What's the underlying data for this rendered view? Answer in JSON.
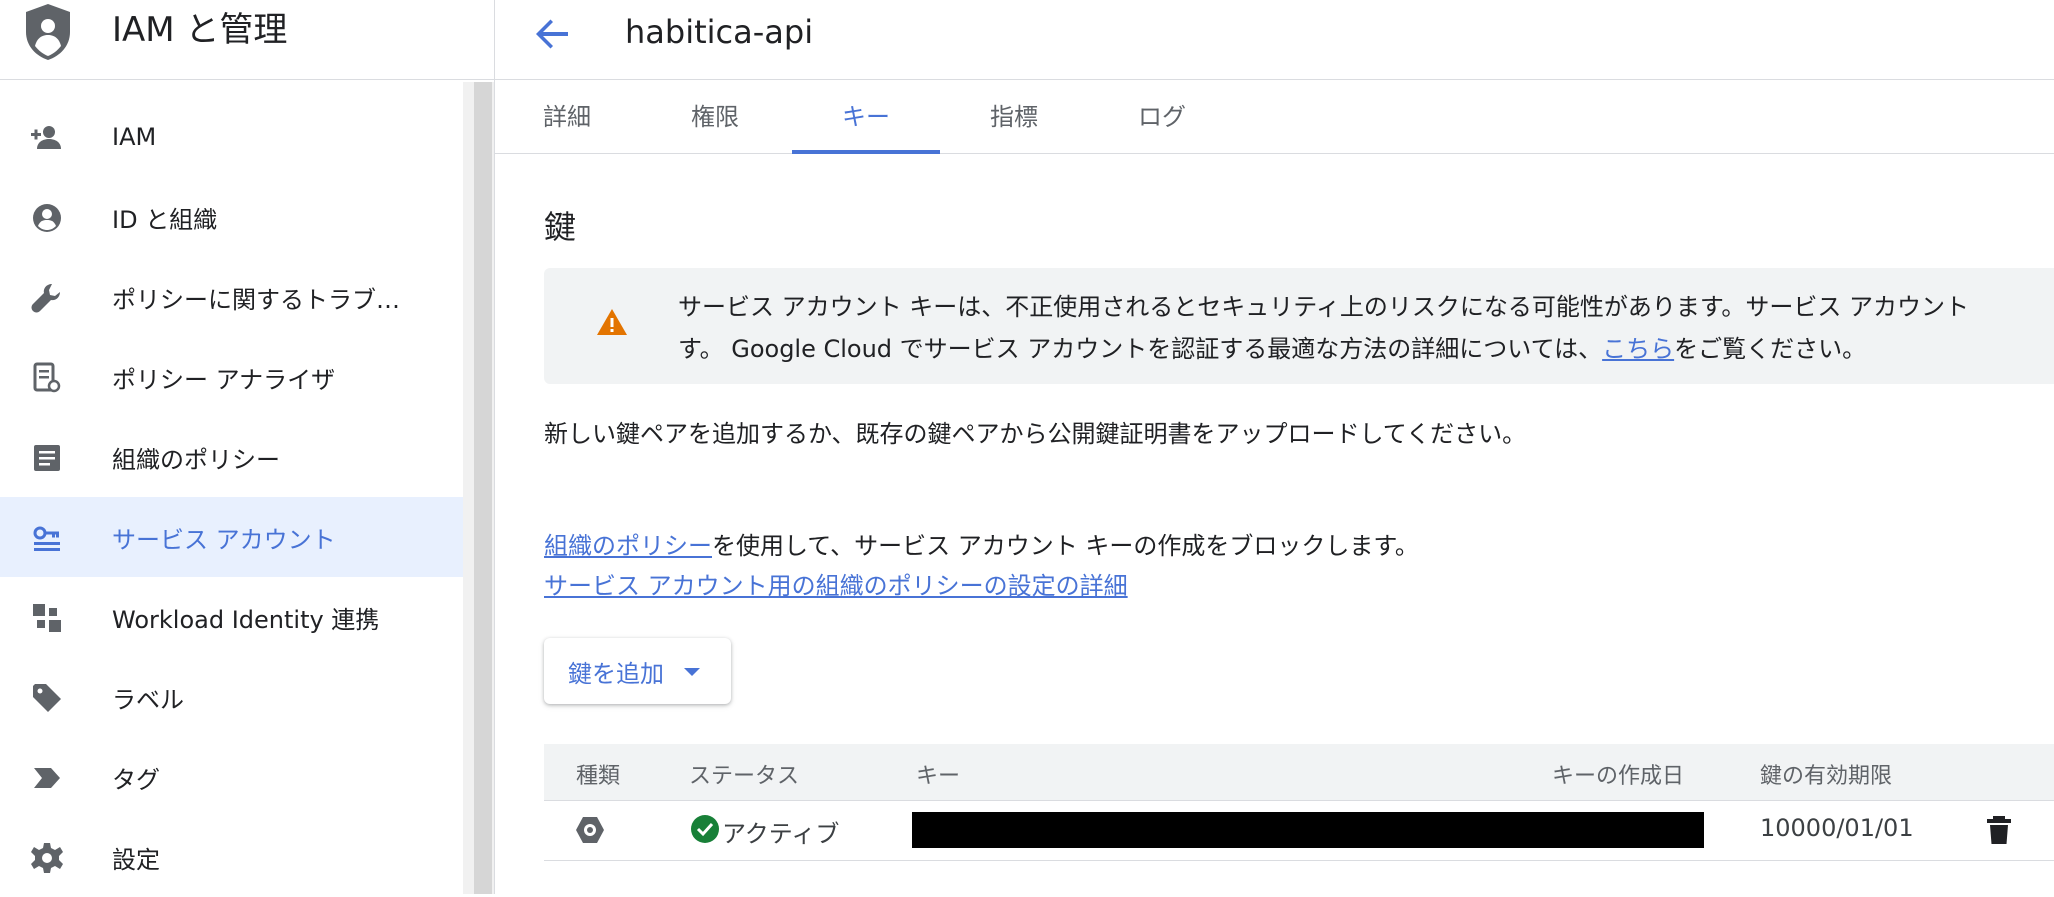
{
  "app": {
    "title": "IAM と管理"
  },
  "nav": {
    "items": [
      {
        "label": "IAM",
        "icon": "person-add-icon"
      },
      {
        "label": "ID と組織",
        "icon": "account-circle-icon"
      },
      {
        "label": "ポリシーに関するトラブ…",
        "icon": "wrench-icon"
      },
      {
        "label": "ポリシー アナライザ",
        "icon": "policy-analyzer-icon"
      },
      {
        "label": "組織のポリシー",
        "icon": "list-document-icon"
      },
      {
        "label": "サービス アカウント",
        "icon": "service-account-icon",
        "active": true
      },
      {
        "label": "Workload Identity 連携",
        "icon": "workload-identity-icon"
      },
      {
        "label": "ラベル",
        "icon": "label-tag-icon"
      },
      {
        "label": "タグ",
        "icon": "tag-arrow-icon"
      },
      {
        "label": "設定",
        "icon": "gear-icon"
      }
    ]
  },
  "header": {
    "title": "habitica-api"
  },
  "tabs": [
    {
      "label": "詳細"
    },
    {
      "label": "権限"
    },
    {
      "label": "キー",
      "active": true
    },
    {
      "label": "指標"
    },
    {
      "label": "ログ"
    }
  ],
  "section": {
    "title": "鍵"
  },
  "warning": {
    "line1": "サービス アカウント キーは、不正使用されるとセキュリティ上のリスクになる可能性があります。サービス アカウント",
    "line2_before": "す。 Google Cloud でサービス アカウントを認証する最適な方法の詳細については、",
    "line2_link": "こちら",
    "line2_after": "をご覧ください。"
  },
  "body": {
    "text": "新しい鍵ペアを追加するか、既存の鍵ペアから公開鍵証明書をアップロードしてください。"
  },
  "policy": {
    "link1": "組織のポリシー",
    "text1": "を使用して、サービス アカウント キーの作成をブロックします。",
    "link2": "サービス アカウント用の組織のポリシーの設定の詳細"
  },
  "add_key": {
    "label": "鍵を追加"
  },
  "table": {
    "headers": [
      "種類",
      "ステータス",
      "キー",
      "キーの作成日",
      "鍵の有効期限"
    ],
    "rows": [
      {
        "status": "アクティブ",
        "key": "",
        "created": "",
        "expires": "10000/01/01"
      }
    ]
  },
  "colors": {
    "accent": "#4873d6",
    "warning": "#e37400",
    "success": "#188038",
    "active_bg": "#e8f0fe"
  }
}
